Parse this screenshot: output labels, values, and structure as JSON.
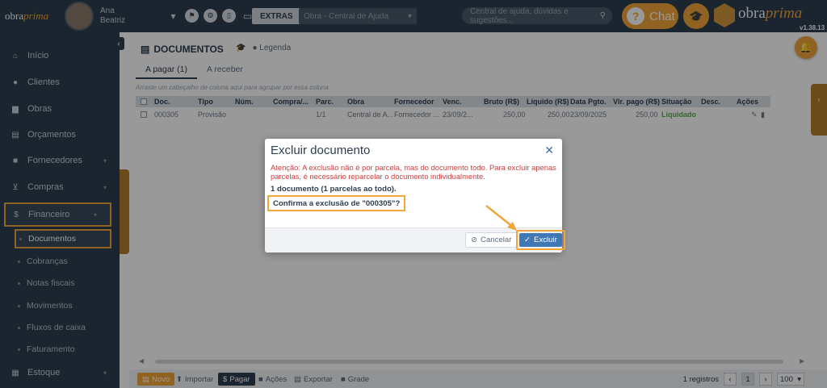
{
  "topbar": {
    "brand_small": "obra",
    "brand_small_accent": "prima",
    "user_name_line1": "Ana",
    "user_name_line2": "Beatriz",
    "extras_label": "EXTRAS",
    "select_placeholder": "Obra - Central de Ajuda",
    "search_placeholder": "Central de ajuda, dúvidas e sugestões...",
    "chat_label": "Chat",
    "brand_big": "obra",
    "brand_big_accent": "prima",
    "version": "v1.38.13"
  },
  "sidebar": {
    "items": [
      {
        "label": "Início",
        "icon": "home-icon"
      },
      {
        "label": "Clientes",
        "icon": "user-icon"
      },
      {
        "label": "Obras",
        "icon": "building-icon"
      },
      {
        "label": "Orçamentos",
        "icon": "document-icon"
      },
      {
        "label": "Fornecedores",
        "icon": "truck-icon"
      },
      {
        "label": "Compras",
        "icon": "cart-icon"
      },
      {
        "label": "Financeiro",
        "icon": "dollar-icon"
      },
      {
        "label": "Estoque",
        "icon": "box-icon"
      }
    ],
    "financeiro_sub": [
      {
        "label": "Documentos"
      },
      {
        "label": "Cobranças"
      },
      {
        "label": "Notas fiscais"
      },
      {
        "label": "Movimentos"
      },
      {
        "label": "Fluxos de caixa"
      },
      {
        "label": "Faturamento"
      }
    ]
  },
  "main": {
    "page_title": "DOCUMENTOS",
    "legend_label": "Legenda",
    "tabs": [
      {
        "label": "A pagar (1)"
      },
      {
        "label": "A receber"
      }
    ],
    "group_hint": "Arraste um cabeçalho de coluna aqui para agrupar por essa coluna",
    "columns": [
      "Doc.",
      "Tipo",
      "Núm.",
      "Compra/...",
      "Parc.",
      "Obra",
      "Fornecedor",
      "Venc.",
      "Bruto (R$)",
      "Líquido (R$)",
      "Data Pgto.",
      "Vlr. pago (R$)",
      "Situação",
      "Desc.",
      "Ações"
    ],
    "rows": [
      {
        "doc": "000305",
        "tipo": "Provisão",
        "num": "",
        "compra": "",
        "parc": "1/1",
        "obra": "Central de A...",
        "fornecedor": "Fornecedor ...",
        "venc": "23/09/2...",
        "bruto": "250,00",
        "liquido": "250,00",
        "data_pgto": "23/09/2025",
        "vlr_pago": "250,00",
        "situacao": "Liquidado",
        "desc": ""
      }
    ],
    "bottom": {
      "novo": "Novo",
      "importar": "Importar",
      "pagar": "Pagar",
      "acoes": "Ações",
      "exportar": "Exportar",
      "grade": "Grade",
      "records": "1 registros",
      "page": "1",
      "page_size": "100"
    }
  },
  "modal": {
    "title": "Excluir documento",
    "warning": "Atenção: A exclusão não é por parcela, mas do documento todo. Para excluir apenas parcelas, é necessário reparcelar o documento individualmente.",
    "count": "1 documento (1 parcelas ao todo).",
    "confirm": "Confirma a exclusão de \"000305\"?",
    "cancel_label": "Cancelar",
    "ok_label": "Excluir"
  },
  "colors": {
    "accent": "#f0a63a",
    "nav_bg": "#2e3e50",
    "primary_button": "#3f78b5",
    "danger_text": "#d23c3c",
    "success_text": "#5aa84a"
  }
}
